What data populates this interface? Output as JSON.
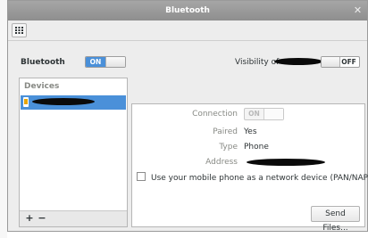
{
  "window": {
    "title": "Bluetooth",
    "close_icon": "close-icon"
  },
  "toolbar": {
    "apps_icon": "grid-icon"
  },
  "bluetooth": {
    "label": "Bluetooth",
    "switch_on_text": "ON"
  },
  "visibility": {
    "label": "Visibility of",
    "switch_off_text": "OFF"
  },
  "devices": {
    "header": "Devices",
    "add_label": "+",
    "remove_label": "−"
  },
  "details": {
    "connection_label": "Connection",
    "connection_switch_text": "ON",
    "paired_label": "Paired",
    "paired_value": "Yes",
    "type_label": "Type",
    "type_value": "Phone",
    "address_label": "Address",
    "network_checkbox_label": "Use your mobile phone as a network device (PAN/NAP)",
    "send_files_label": "Send Files..."
  },
  "colors": {
    "accent": "#4a90d9",
    "titlebar": "#9a9a9a",
    "window_bg": "#ededed"
  }
}
